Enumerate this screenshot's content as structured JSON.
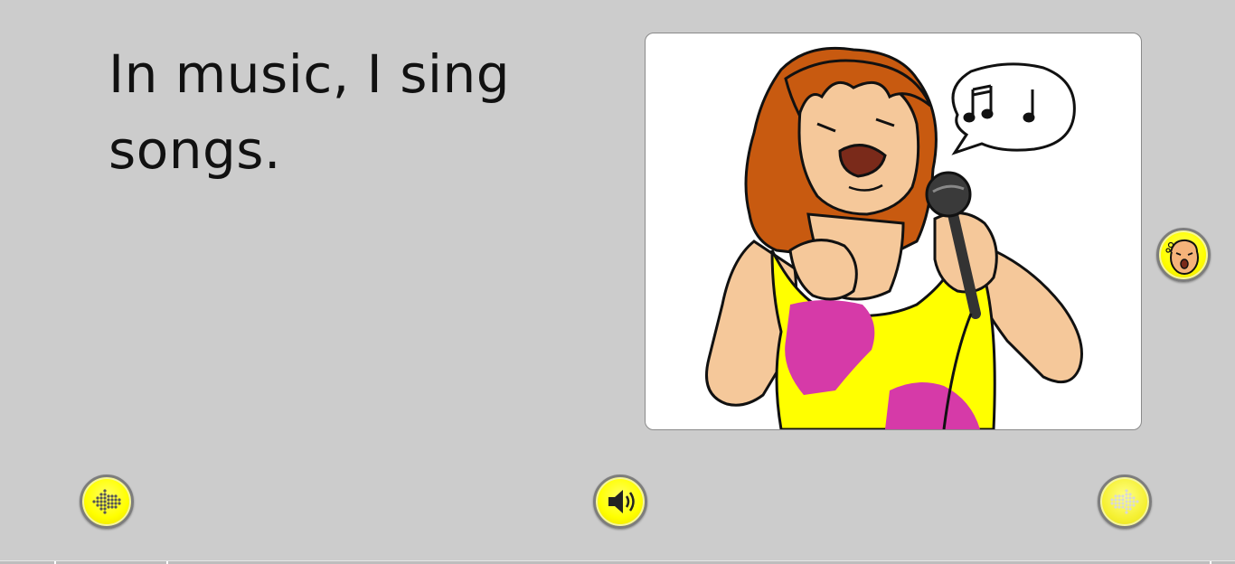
{
  "page": {
    "text": "In music, I sing songs."
  },
  "picture": {
    "semantic": "girl-singing-into-microphone-illustration"
  },
  "controls": {
    "back_icon": "left-arrow-icon",
    "sound_icon": "speaker-icon",
    "next_icon": "right-arrow-icon",
    "speak_icon": "singing-face-icon"
  },
  "colors": {
    "background": "#cccccc",
    "button": "#ffff00",
    "button_border": "#7d7d7d",
    "hair": "#c85a10",
    "skin": "#f5c89a",
    "shirt_yellow": "#ffff00",
    "shirt_pink": "#d63aa8"
  }
}
